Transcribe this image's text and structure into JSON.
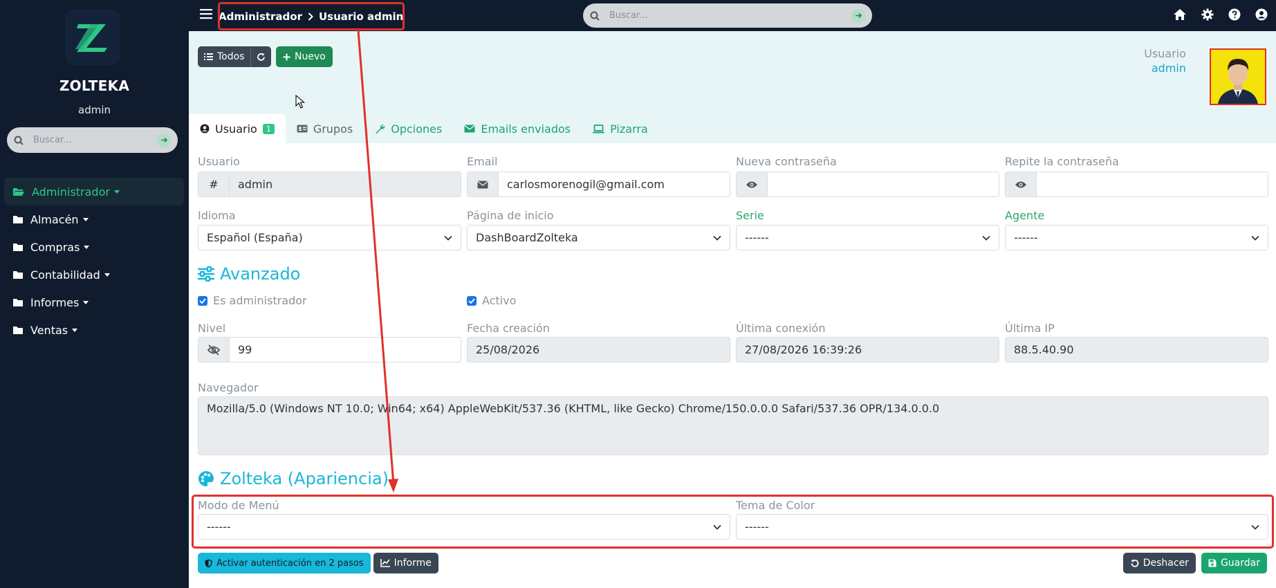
{
  "sidebar": {
    "brand": "ZOLTEKA",
    "user": "admin",
    "search_placeholder": "Buscar...",
    "items": [
      {
        "label": "Administrador"
      },
      {
        "label": "Almacén"
      },
      {
        "label": "Compras"
      },
      {
        "label": "Contabilidad"
      },
      {
        "label": "Informes"
      },
      {
        "label": "Ventas"
      }
    ]
  },
  "topbar": {
    "breadcrumb_parent": "Administrador",
    "breadcrumb_current": "Usuario admin",
    "search_placeholder": "Buscar..."
  },
  "toolbar": {
    "all_label": "Todos",
    "new_label": "Nuevo"
  },
  "header": {
    "user_label": "Usuario",
    "user_value": "admin"
  },
  "tabs": [
    {
      "label": "Usuario",
      "badge": "1"
    },
    {
      "label": "Grupos"
    },
    {
      "label": "Opciones"
    },
    {
      "label": "Emails enviados"
    },
    {
      "label": "Pizarra"
    }
  ],
  "form": {
    "usuario_label": "Usuario",
    "usuario_addon": "#",
    "usuario_value": "admin",
    "email_label": "Email",
    "email_value": "carlosmorenogil@gmail.com",
    "newpass_label": "Nueva contraseña",
    "repeatpass_label": "Repite la contraseña",
    "idioma_label": "Idioma",
    "idioma_value": "Español (España)",
    "home_label": "Página de inicio",
    "home_value": "DashBoardZolteka",
    "serie_label": "Serie",
    "serie_value": "------",
    "agente_label": "Agente",
    "agente_value": "------",
    "advanced_title": "Avanzado",
    "admin_check": "Es administrador",
    "active_check": "Activo",
    "nivel_label": "Nivel",
    "nivel_value": "99",
    "fecha_label": "Fecha creación",
    "fecha_value": "25/08/2026",
    "conexion_label": "Última conexión",
    "conexion_value": "27/08/2026 16:39:26",
    "ip_label": "Última IP",
    "ip_value": "88.5.40.90",
    "navegador_label": "Navegador",
    "navegador_value": "Mozilla/5.0 (Windows NT 10.0; Win64; x64) AppleWebKit/537.36 (KHTML, like Gecko) Chrome/150.0.0.0 Safari/537.36 OPR/134.0.0.0",
    "appearance_title": "Zolteka (Apariencia)",
    "menu_mode_label": "Modo de Menú",
    "menu_mode_value": "------",
    "theme_label": "Tema de Color",
    "theme_value": "------"
  },
  "footer": {
    "twofa_label": "Activar autenticación en 2 pasos",
    "report_label": "Informe",
    "undo_label": "Deshacer",
    "save_label": "Guardar"
  },
  "colors": {
    "accent": "#2ec787",
    "cyan": "#19b7d9",
    "annotation": "#e0302b",
    "sidebar_bg": "#101c2d"
  }
}
